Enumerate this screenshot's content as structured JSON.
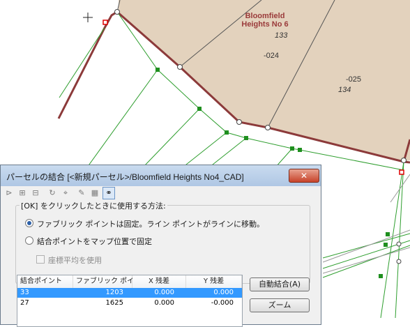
{
  "map": {
    "title_line1": "Bloomfield",
    "title_line2": "Heights No 6",
    "labels": [
      "133",
      "-024",
      "-025",
      "134"
    ]
  },
  "dialog": {
    "title": "パーセルの結合 [<新規パーセル>/Bloomfield Heights No4_CAD]",
    "close_label": "✕",
    "group_label": "[OK] をクリックしたときに使用する方法:",
    "option1": "ファブリック ポイントは固定。ライン ポイントがラインに移動。",
    "option2": "結合ポイントをマップ位置で固定",
    "checkbox_label": "座標平均を使用",
    "table": {
      "headers": [
        "結合ポイント",
        "ファブリック ポイ...",
        "X 残差",
        "Y 残差"
      ],
      "rows": [
        [
          "33",
          "1203",
          "0.000",
          "0.000"
        ],
        [
          "27",
          "1625",
          "0.000",
          "-0.000"
        ]
      ]
    },
    "auto_join_label": "自動結合(A)",
    "zoom_label": "ズーム"
  }
}
